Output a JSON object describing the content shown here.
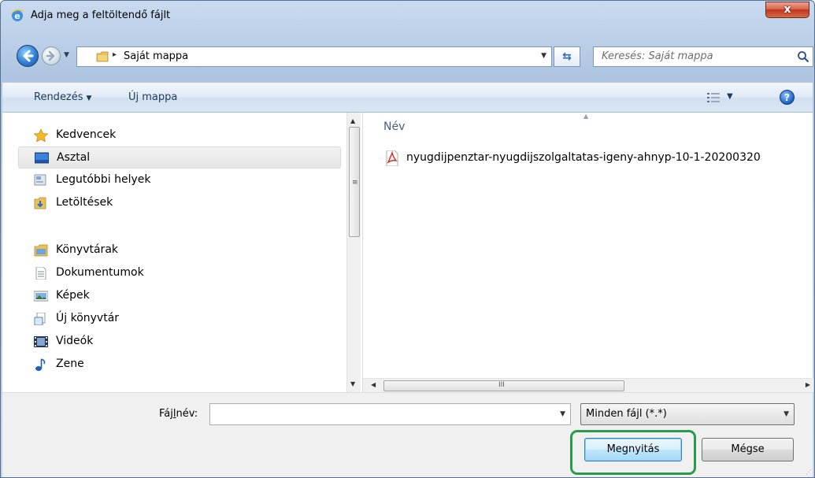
{
  "window": {
    "title": "Adja meg a feltöltendő fájlt",
    "close_label": "x"
  },
  "navigation": {
    "back_icon": "back-arrow-icon",
    "forward_icon": "forward-arrow-icon",
    "breadcrumb_separator": "▸",
    "address": "Saját mappa",
    "refresh_label": "⇆",
    "search_placeholder": "Keresés: Saját mappa"
  },
  "toolbar": {
    "organize_label": "Rendezés",
    "new_folder_label": "Új mappa",
    "help_label": "?"
  },
  "nav_pane": {
    "favorites": {
      "label": "Kedvencek",
      "items": [
        {
          "label": "Asztal",
          "icon": "desktop-icon",
          "selected": true
        },
        {
          "label": "Legutóbbi helyek",
          "icon": "recent-places-icon"
        },
        {
          "label": "Letöltések",
          "icon": "downloads-icon"
        }
      ]
    },
    "libraries": {
      "label": "Könyvtárak",
      "items": [
        {
          "label": "Dokumentumok",
          "icon": "documents-icon"
        },
        {
          "label": "Képek",
          "icon": "pictures-icon"
        },
        {
          "label": "Új könyvtár",
          "icon": "library-icon"
        },
        {
          "label": "Videók",
          "icon": "videos-icon"
        },
        {
          "label": "Zene",
          "icon": "music-icon"
        }
      ]
    }
  },
  "file_list": {
    "columns": [
      "Név"
    ],
    "files": [
      {
        "name": "nyugdijpenztar-nyugdijszolgaltatas-igeny-ahnyp-10-1-20200320",
        "icon": "pdf-icon"
      }
    ],
    "hscroll_grip": "III"
  },
  "footer": {
    "filename_label_prefix": "Fáj",
    "filename_label_underlined": "l",
    "filename_label_suffix": "név:",
    "filename_value": "",
    "filetype_value": "Minden fájl (*.*)",
    "open_label": "Megnyitás",
    "cancel_label": "Mégse"
  },
  "colors": {
    "highlight": "#2a9b4b",
    "close_button": "#c0361c"
  }
}
